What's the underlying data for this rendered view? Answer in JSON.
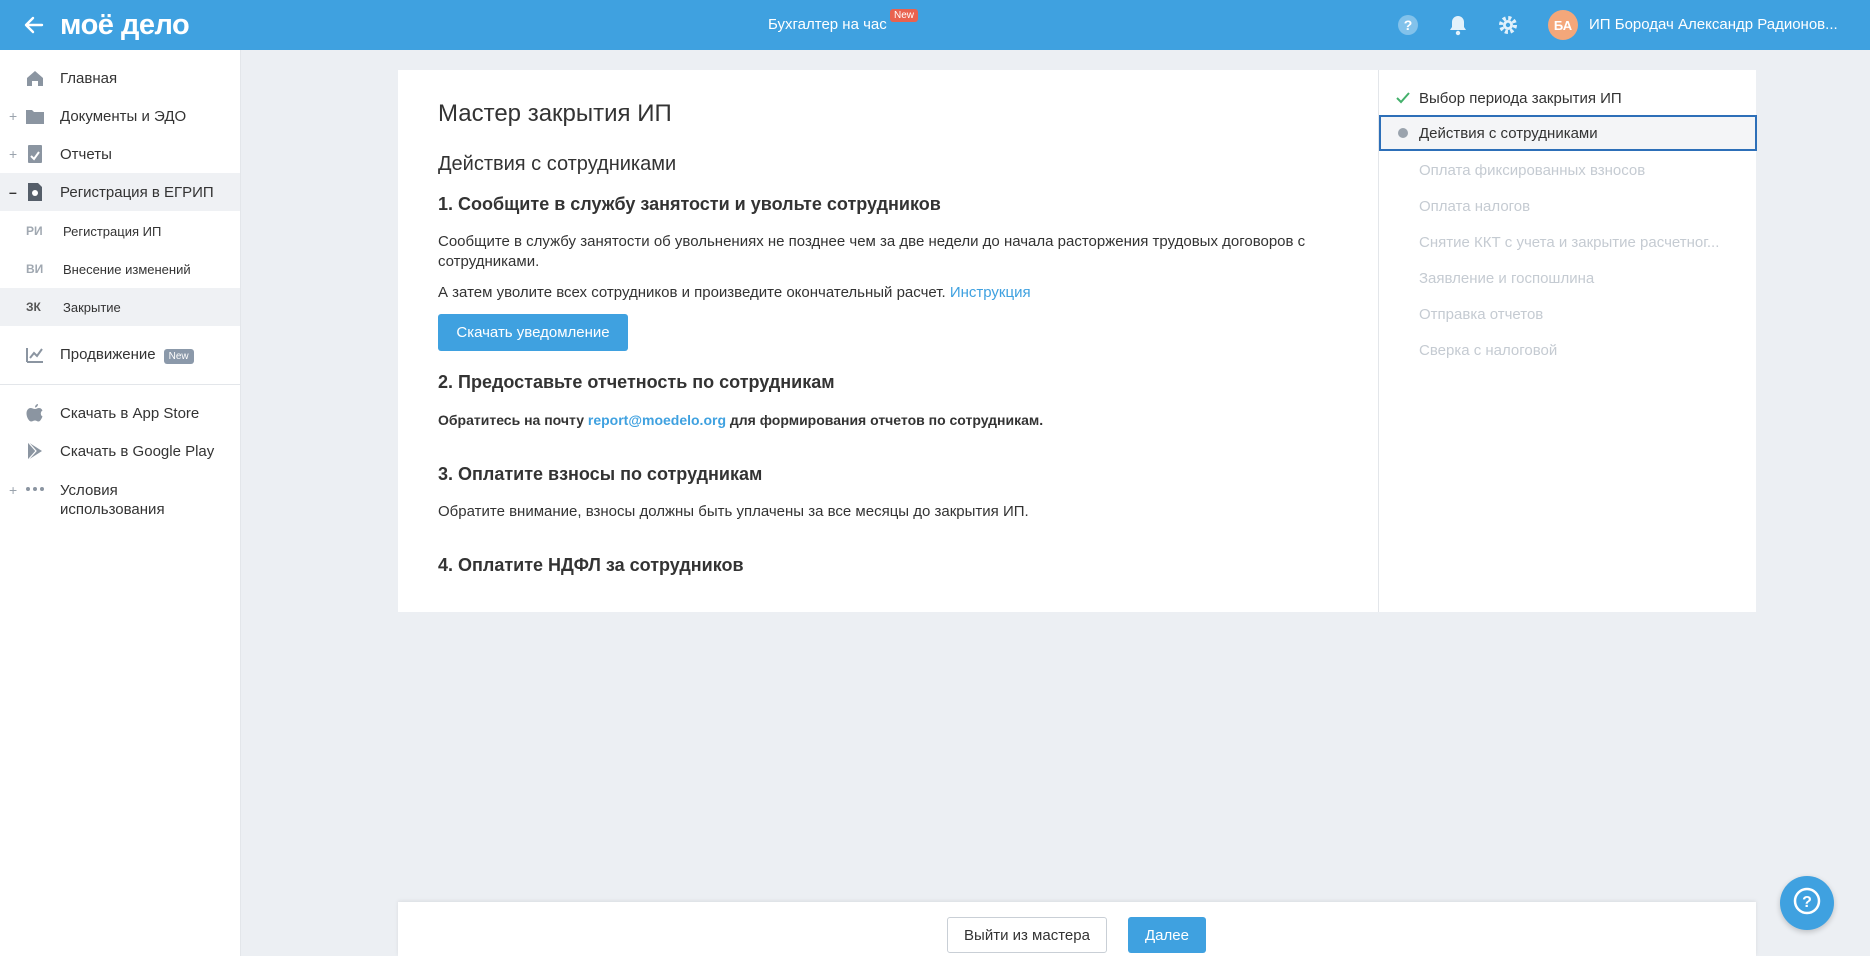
{
  "header": {
    "logo": "моё дело",
    "center_link": "Бухгалтер на час",
    "center_badge": "New",
    "avatar_initials": "БА",
    "user_name": "ИП Бородач Александр Радионов..."
  },
  "sidebar": {
    "items": [
      {
        "label": "Главная",
        "icon": "home-icon",
        "expandable": false
      },
      {
        "label": "Документы и ЭДО",
        "icon": "folder-icon",
        "expandable": true
      },
      {
        "label": "Отчеты",
        "icon": "report-icon",
        "expandable": true
      },
      {
        "label": "Регистрация в ЕГРИП",
        "icon": "registration-icon",
        "expandable": true,
        "expanded": true
      }
    ],
    "subitems": [
      {
        "abbr": "РИ",
        "label": "Регистрация ИП"
      },
      {
        "abbr": "ВИ",
        "label": "Внесение изменений"
      },
      {
        "abbr": "ЗК",
        "label": "Закрытие",
        "active": true
      }
    ],
    "promo": {
      "label": "Продвижение",
      "badge": "New"
    },
    "links": [
      {
        "label": "Скачать в App Store",
        "icon": "apple-icon"
      },
      {
        "label": "Скачать в Google Play",
        "icon": "google-play-icon"
      },
      {
        "label": "Условия использования",
        "icon": "more-icon"
      }
    ]
  },
  "main": {
    "title": "Мастер закрытия ИП",
    "section_title": "Действия с сотрудниками",
    "step1": {
      "heading": "1. Сообщите в службу занятости и увольте сотрудников",
      "text1": "Сообщите в службу занятости об увольнениях не позднее чем за две недели до начала расторжения трудовых договоров с сотрудниками.",
      "text2_prefix": "А затем уволите всех сотрудников и произведите окончательный расчет.",
      "text2_link": "Инструкция",
      "button": "Скачать уведомление"
    },
    "step2": {
      "heading": "2. Предоставьте отчетность по сотрудникам",
      "text_prefix": "Обратитесь на почту",
      "email": "report@moedelo.org",
      "text_suffix": "для формирования отчетов по сотрудникам."
    },
    "step3": {
      "heading": "3. Оплатите взносы по сотрудникам",
      "text": "Обратите внимание, взносы должны быть уплачены за все месяцы до закрытия ИП."
    },
    "step4": {
      "heading": "4. Оплатите НДФЛ за сотрудников"
    }
  },
  "steps": [
    {
      "label": "Выбор периода закрытия ИП",
      "status": "done"
    },
    {
      "label": "Действия с сотрудниками",
      "status": "current"
    },
    {
      "label": "Оплата фиксированных взносов",
      "status": "todo"
    },
    {
      "label": "Оплата налогов",
      "status": "todo"
    },
    {
      "label": "Снятие ККТ с учета и закрытие расчетног...",
      "status": "todo"
    },
    {
      "label": "Заявление и госпошлина",
      "status": "todo"
    },
    {
      "label": "Отправка отчетов",
      "status": "todo"
    },
    {
      "label": "Сверка с налоговой",
      "status": "todo"
    }
  ],
  "footer": {
    "exit_button": "Выйти из мастера",
    "next_button": "Далее"
  }
}
